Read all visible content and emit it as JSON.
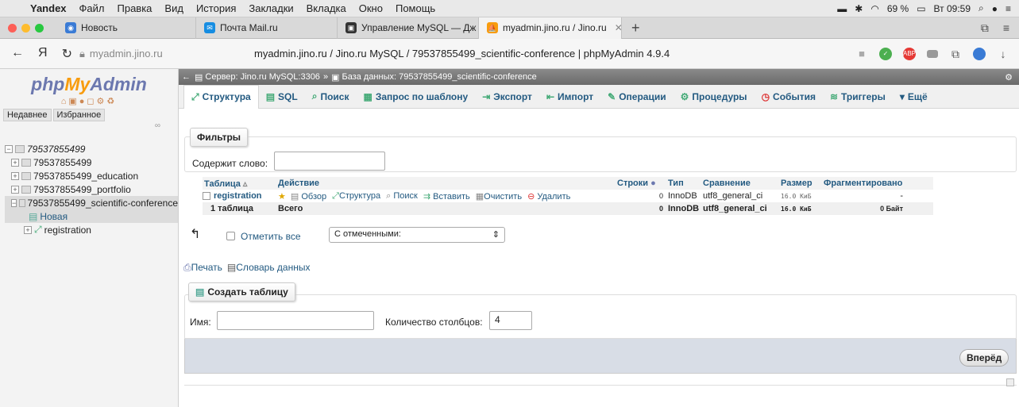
{
  "menubar": {
    "app": "Yandex",
    "items": [
      "Файл",
      "Правка",
      "Вид",
      "История",
      "Закладки",
      "Вкладка",
      "Окно",
      "Помощь"
    ],
    "battery": "69 %",
    "clock": "Вт 09:59"
  },
  "tabs": [
    {
      "label": "Новость",
      "color": "#3a7bd5"
    },
    {
      "label": "Почта Mail.ru",
      "color": "#168de2"
    },
    {
      "label": "Управление MySQL — Дж",
      "color": "#333333"
    },
    {
      "label": "myadmin.jino.ru / Jino.ru",
      "color": "#f89c0e"
    }
  ],
  "address": {
    "host": "myadmin.jino.ru",
    "title": "myadmin.jino.ru / Jino.ru MySQL / 79537855499_scientific-conference | phpMyAdmin 4.9.4"
  },
  "sidebar": {
    "logo_php": "php",
    "logo_my": "My",
    "logo_admin": "Admin",
    "tab_recent": "Недавнее",
    "tab_fav": "Избранное",
    "root": "79537855499",
    "dbs": [
      "79537855499",
      "79537855499_education",
      "79537855499_portfolio",
      "79537855499_scientific-conference"
    ],
    "new_label": "Новая",
    "table": "registration"
  },
  "breadcrumb": {
    "server": "Сервер: Jino.ru MySQL:3306",
    "database": "База данных: 79537855499_scientific-conference"
  },
  "toptabs": [
    {
      "label": "Структура",
      "icon": "structure-icon"
    },
    {
      "label": "SQL",
      "icon": "sql-icon"
    },
    {
      "label": "Поиск",
      "icon": "search-icon"
    },
    {
      "label": "Запрос по шаблону",
      "icon": "query-icon"
    },
    {
      "label": "Экспорт",
      "icon": "export-icon"
    },
    {
      "label": "Импорт",
      "icon": "import-icon"
    },
    {
      "label": "Операции",
      "icon": "wrench-icon"
    },
    {
      "label": "Процедуры",
      "icon": "routines-icon"
    },
    {
      "label": "События",
      "icon": "events-icon"
    },
    {
      "label": "Триггеры",
      "icon": "triggers-icon"
    },
    {
      "label": "Ещё",
      "icon": "more-icon"
    }
  ],
  "filters": {
    "legend": "Фильтры",
    "label": "Содержит слово:",
    "value": ""
  },
  "table": {
    "headers": {
      "table": "Таблица",
      "action": "Действие",
      "rows": "Строки",
      "type": "Тип",
      "collation": "Сравнение",
      "size": "Размер",
      "overhead": "Фрагментировано"
    },
    "row": {
      "name": "registration",
      "actions": [
        "Обзор",
        "Структура",
        "Поиск",
        "Вставить",
        "Очистить",
        "Удалить"
      ],
      "rows": "0",
      "type": "InnoDB",
      "collation": "utf8_general_ci",
      "size": "16.0 КиБ",
      "overhead": "-"
    },
    "total": {
      "count": "1 таблица",
      "label": "Всего",
      "rows": "0",
      "type": "InnoDB",
      "collation": "utf8_general_ci",
      "size": "16.0 КиБ",
      "overhead": "0 Байт"
    }
  },
  "bulk": {
    "check_all": "Отметить все",
    "with_selected": "С отмеченными:"
  },
  "links": {
    "print": "Печать",
    "dictionary": "Словарь данных"
  },
  "create": {
    "legend": "Создать таблицу",
    "name_label": "Имя:",
    "name_value": "",
    "cols_label": "Количество столбцов:",
    "cols_value": "4",
    "go": "Вперёд"
  }
}
